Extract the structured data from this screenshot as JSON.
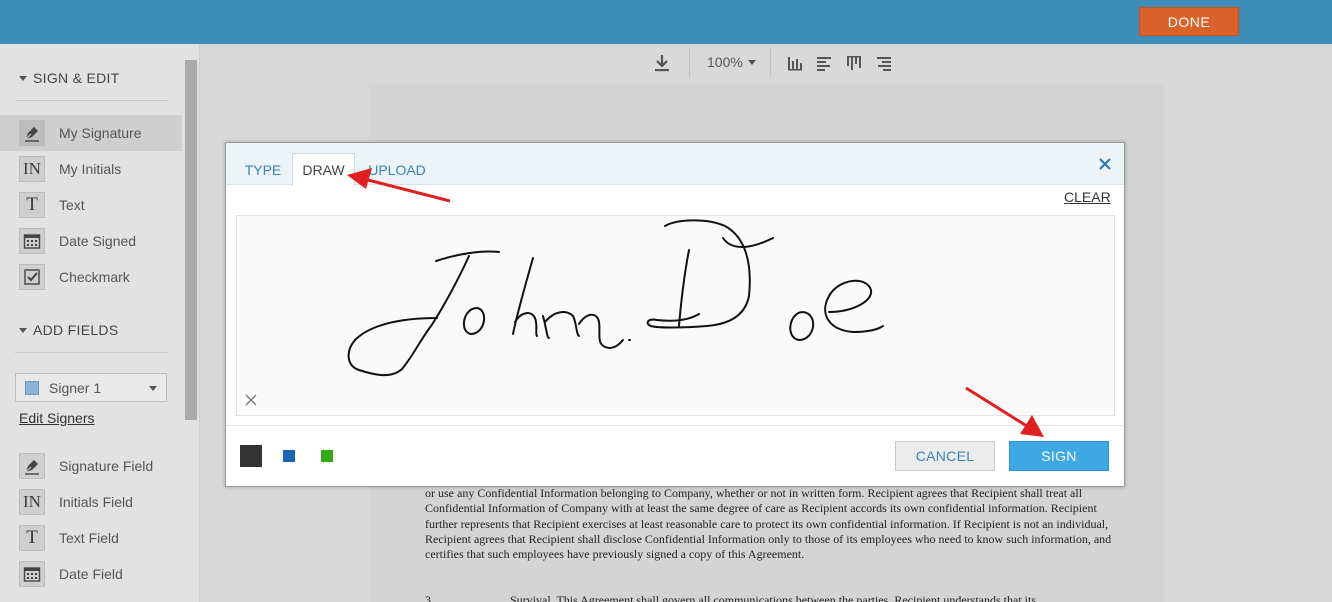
{
  "topbar": {
    "done_label": "DONE"
  },
  "sidebar": {
    "sign_edit_heading": "SIGN & EDIT",
    "sign_items": [
      {
        "label": "My Signature",
        "icon": "pen-nib-icon",
        "active": true
      },
      {
        "label": "My Initials",
        "icon": "initials-icon",
        "glyph": "IN"
      },
      {
        "label": "Text",
        "icon": "text-icon",
        "glyph": "T"
      },
      {
        "label": "Date Signed",
        "icon": "calendar-icon"
      },
      {
        "label": "Checkmark",
        "icon": "checkmark-icon"
      }
    ],
    "add_fields_heading": "ADD FIELDS",
    "signer_select": {
      "value": "Signer 1",
      "color": "#8bb3d9"
    },
    "edit_signers_label": "Edit Signers",
    "field_items": [
      {
        "label": "Signature Field",
        "icon": "pen-nib-icon"
      },
      {
        "label": "Initials Field",
        "icon": "initials-icon",
        "glyph": "IN"
      },
      {
        "label": "Text Field",
        "icon": "text-icon",
        "glyph": "T"
      },
      {
        "label": "Date Field",
        "icon": "calendar-icon"
      }
    ]
  },
  "toolbar": {
    "zoom_value": "100%",
    "icons": [
      "download-icon",
      "align-bottom-icon",
      "align-left-icon",
      "align-top-icon",
      "align-right-icon"
    ]
  },
  "document": {
    "paragraph": "or use any Confidential Information belonging to Company, whether or not in written form.  Recipient agrees that Recipient shall treat all Confidential Information of Company with at least the same degree of care as Recipient accords its own confidential information.  Recipient further represents that Recipient exercises at least reasonable care to protect its own confidential information.  If Recipient is not an individual, Recipient agrees that Recipient shall disclose Confidential Information only to those of its employees who need to know such information, and certifies that such employees have previously signed a copy of this Agreement.",
    "next_line_number": "3.",
    "next_line": "Survival.  This Agreement shall govern all communications between the parties.  Recipient understands that its"
  },
  "modal": {
    "tabs": [
      "TYPE",
      "DRAW",
      "UPLOAD"
    ],
    "active_tab": "DRAW",
    "clear_label": "CLEAR",
    "cancel_label": "CANCEL",
    "sign_label": "SIGN",
    "ink_colors": [
      "#333333",
      "#1a66b3",
      "#33aa11"
    ],
    "signature_text": "John Doe"
  },
  "colors": {
    "topbar": "#3e8cb8",
    "done": "#d9622b",
    "sign_button": "#3ea8e5",
    "annotation_arrow": "#e02020"
  }
}
